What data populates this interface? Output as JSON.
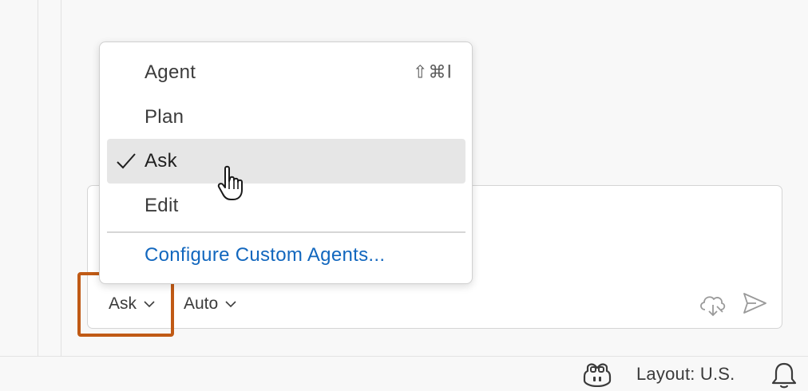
{
  "chat": {
    "mode_picker": {
      "label": "Ask"
    },
    "model_picker": {
      "label": "Auto"
    }
  },
  "mode_menu": {
    "items": [
      {
        "label": "Agent",
        "shortcut": "⇧⌘I",
        "selected": false
      },
      {
        "label": "Plan",
        "shortcut": "",
        "selected": false
      },
      {
        "label": "Ask",
        "shortcut": "",
        "selected": true
      },
      {
        "label": "Edit",
        "shortcut": "",
        "selected": false
      }
    ],
    "configure_link": "Configure Custom Agents..."
  },
  "status_bar": {
    "layout": "Layout: U.S."
  },
  "icons": {
    "chevron": "chevron-down-icon",
    "check": "check-icon",
    "cloud": "cloud-sync-icon",
    "send": "send-icon",
    "copilot": "copilot-icon",
    "bell": "bell-icon",
    "cursor": "hand-pointer-icon"
  },
  "colors": {
    "highlight_box": "#c05a15",
    "link": "#1267be",
    "selected_bg": "#e6e6e6"
  }
}
